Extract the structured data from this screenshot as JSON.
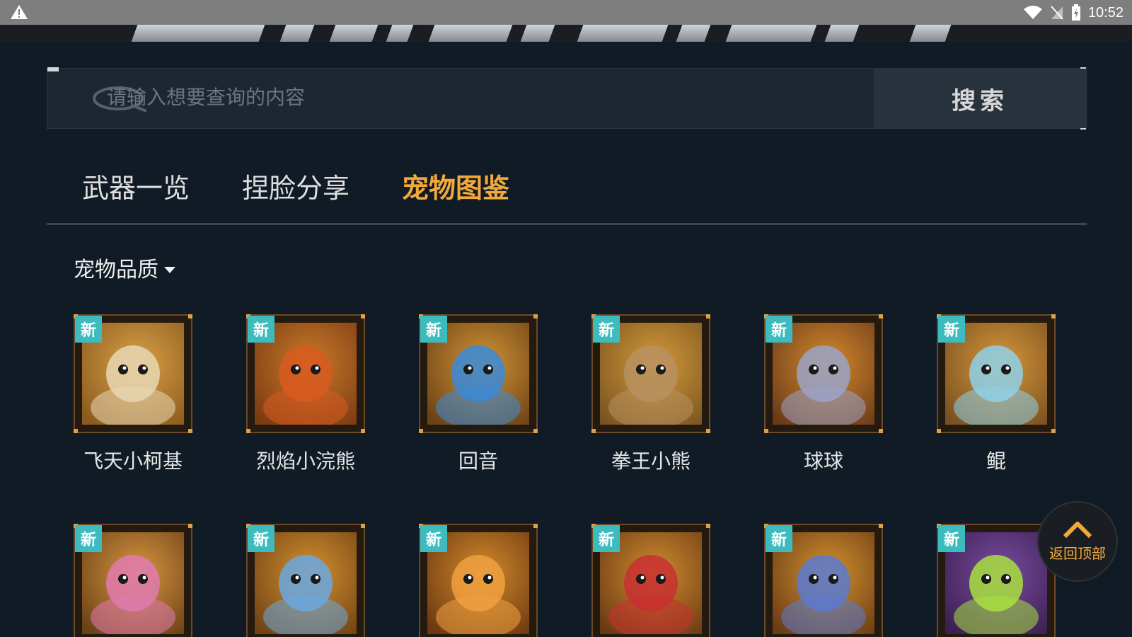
{
  "status_bar": {
    "time": "10:52"
  },
  "search": {
    "placeholder": "请输入想要查询的内容",
    "button_label": "搜索"
  },
  "tabs": [
    {
      "label": "武器一览",
      "active": false
    },
    {
      "label": "捏脸分享",
      "active": false
    },
    {
      "label": "宠物图鉴",
      "active": true
    }
  ],
  "filter": {
    "label": "宠物品质"
  },
  "new_badge": "新",
  "pets": [
    {
      "name": "飞天小柯基",
      "palette": [
        "#d9a047",
        "#8a5a1e",
        "#e8d7b2"
      ]
    },
    {
      "name": "烈焰小浣熊",
      "palette": [
        "#c97a2a",
        "#7a3a12",
        "#d85a20"
      ]
    },
    {
      "name": "回音",
      "palette": [
        "#d19235",
        "#6a4216",
        "#3a8ad8"
      ]
    },
    {
      "name": "拳王小熊",
      "palette": [
        "#d39a3a",
        "#7a5420",
        "#b89060"
      ]
    },
    {
      "name": "球球",
      "palette": [
        "#d48a2e",
        "#6a3a18",
        "#9aa3c8"
      ]
    },
    {
      "name": "鲲",
      "palette": [
        "#d4963a",
        "#7a5020",
        "#8ed0e8"
      ]
    },
    {
      "name": "",
      "palette": [
        "#d89640",
        "#6a4016",
        "#e07ab0"
      ]
    },
    {
      "name": "",
      "palette": [
        "#d49030",
        "#704214",
        "#6aa8e0"
      ]
    },
    {
      "name": "",
      "palette": [
        "#d38a2a",
        "#6a3812",
        "#f0a040"
      ]
    },
    {
      "name": "",
      "palette": [
        "#cf8c2e",
        "#6a3a14",
        "#c83030"
      ]
    },
    {
      "name": "",
      "palette": [
        "#d2902e",
        "#6a3c16",
        "#5a7ad0"
      ]
    },
    {
      "name": "",
      "palette": [
        "#7a4aa0",
        "#3a2050",
        "#a8e040"
      ]
    }
  ],
  "back_to_top": {
    "label": "返回顶部"
  },
  "colors": {
    "accent": "#f2a93b",
    "badge": "#3dbcc0",
    "background": "#101b25"
  }
}
